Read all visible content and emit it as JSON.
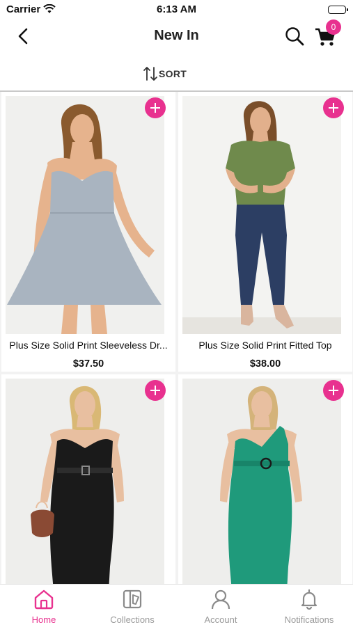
{
  "status_bar": {
    "carrier": "Carrier",
    "time": "6:13 AM"
  },
  "header": {
    "title": "New In",
    "cart_count": "0"
  },
  "toolbar": {
    "sort_label": "SORT"
  },
  "products": [
    {
      "name": "Plus Size Solid Print Sleeveless Dr...",
      "price": "$37.50"
    },
    {
      "name": "Plus Size Solid Print Fitted Top",
      "price": "$38.00"
    },
    {
      "name": "",
      "price": ""
    },
    {
      "name": "",
      "price": ""
    }
  ],
  "tabs": [
    {
      "label": "Home",
      "icon": "home-icon",
      "active": true
    },
    {
      "label": "Collections",
      "icon": "collections-icon",
      "active": false
    },
    {
      "label": "Account",
      "icon": "account-icon",
      "active": false
    },
    {
      "label": "Notifications",
      "icon": "bell-icon",
      "active": false
    }
  ],
  "colors": {
    "accent": "#e8318f",
    "inactive": "#9a9a9a"
  }
}
